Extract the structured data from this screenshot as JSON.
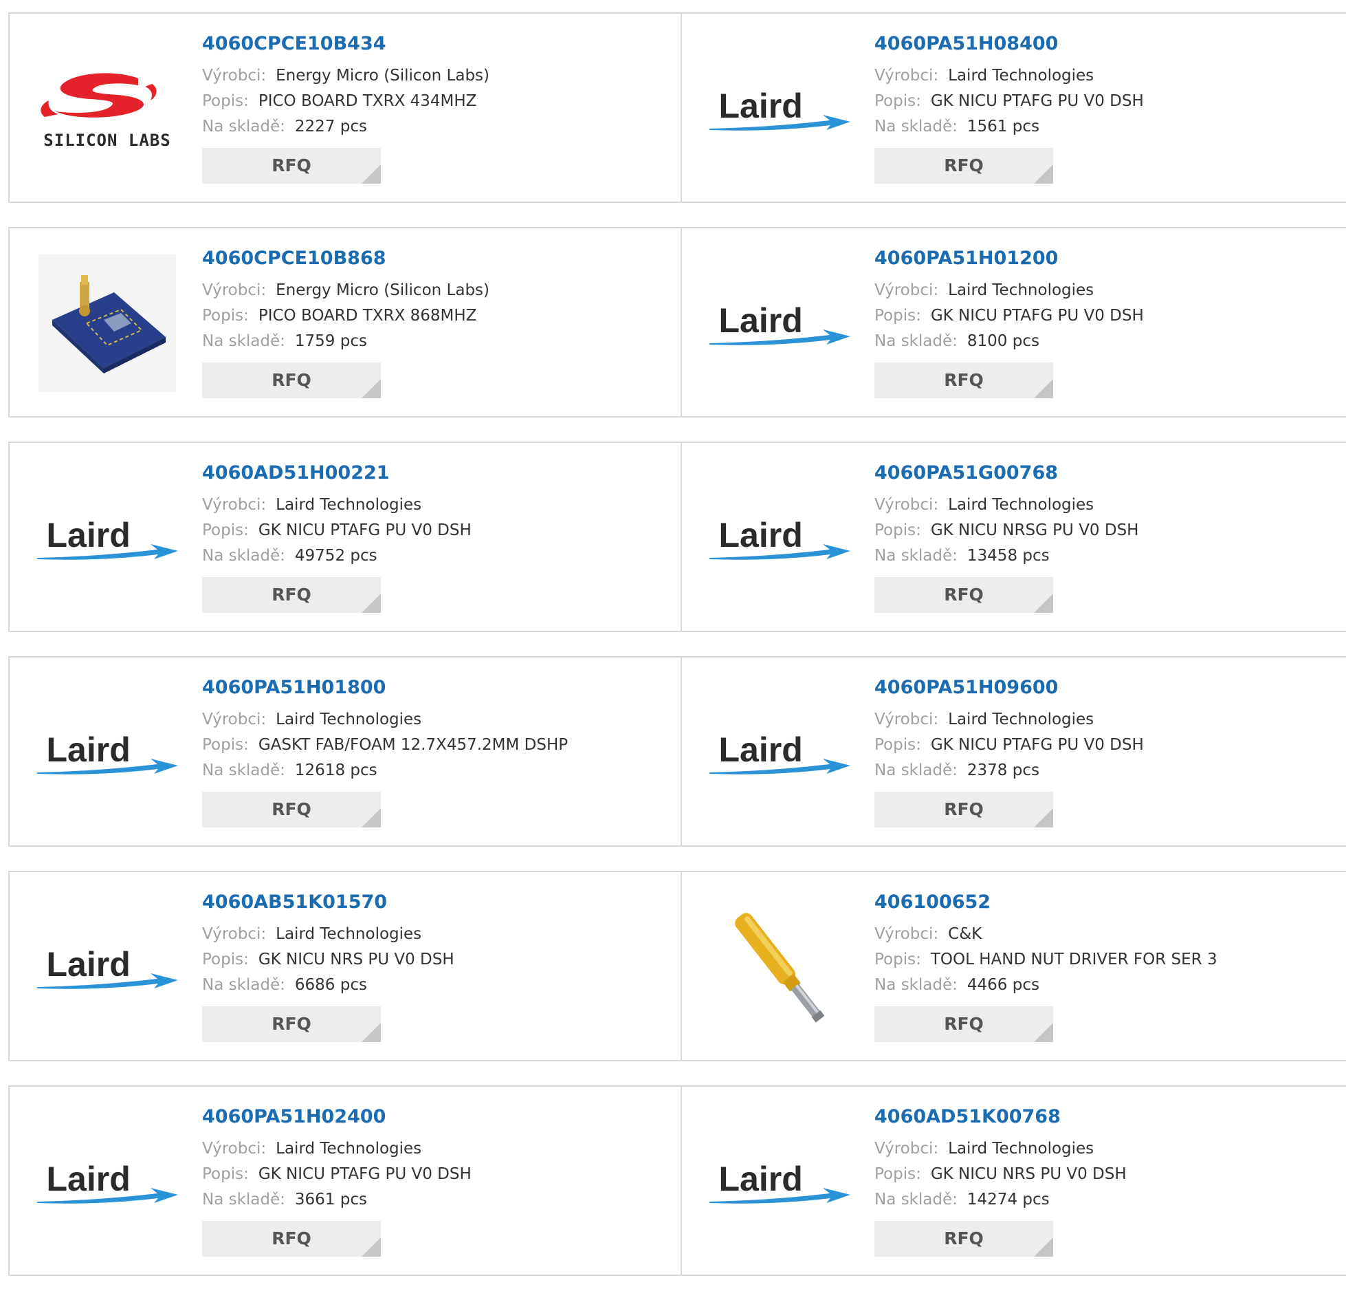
{
  "labels": {
    "manufacturer": "Výrobci:",
    "description": "Popis:",
    "stock": "Na skladě:",
    "rfq": "RFQ"
  },
  "logos": {
    "laird": "Laird",
    "silicon_labs": "SILICON LABS"
  },
  "colors": {
    "part_link": "#1a6bb0",
    "label": "#a0a0a0",
    "value": "#333333",
    "rfq_bg": "#ececec",
    "laird_swoosh": "#2a93d5",
    "silabs_red": "#e3222a"
  },
  "products": [
    {
      "part": "4060CPCE10B434",
      "manufacturer": "Energy Micro (Silicon Labs)",
      "description": "PICO BOARD TXRX 434MHZ",
      "stock": "2227 pcs",
      "image": "silicon-labs-logo"
    },
    {
      "part": "4060PA51H08400",
      "manufacturer": "Laird Technologies",
      "description": "GK NICU PTAFG PU V0 DSH",
      "stock": "1561 pcs",
      "image": "laird-logo"
    },
    {
      "part": "4060CPCE10B868",
      "manufacturer": "Energy Micro (Silicon Labs)",
      "description": "PICO BOARD TXRX 868MHZ",
      "stock": "1759 pcs",
      "image": "pcb-board-photo"
    },
    {
      "part": "4060PA51H01200",
      "manufacturer": "Laird Technologies",
      "description": "GK NICU PTAFG PU V0 DSH",
      "stock": "8100 pcs",
      "image": "laird-logo"
    },
    {
      "part": "4060AD51H00221",
      "manufacturer": "Laird Technologies",
      "description": "GK NICU PTAFG PU V0 DSH",
      "stock": "49752 pcs",
      "image": "laird-logo"
    },
    {
      "part": "4060PA51G00768",
      "manufacturer": "Laird Technologies",
      "description": "GK NICU NRSG PU V0 DSH",
      "stock": "13458 pcs",
      "image": "laird-logo"
    },
    {
      "part": "4060PA51H01800",
      "manufacturer": "Laird Technologies",
      "description": "GASKT FAB/FOAM 12.7X457.2MM DSHP",
      "stock": "12618 pcs",
      "image": "laird-logo"
    },
    {
      "part": "4060PA51H09600",
      "manufacturer": "Laird Technologies",
      "description": "GK NICU PTAFG PU V0 DSH",
      "stock": "2378 pcs",
      "image": "laird-logo"
    },
    {
      "part": "4060AB51K01570",
      "manufacturer": "Laird Technologies",
      "description": "GK NICU NRS PU V0 DSH",
      "stock": "6686 pcs",
      "image": "laird-logo"
    },
    {
      "part": "406100652",
      "manufacturer": "C&K",
      "description": "TOOL HAND NUT DRIVER FOR SER 3",
      "stock": "4466 pcs",
      "image": "nut-driver-photo"
    },
    {
      "part": "4060PA51H02400",
      "manufacturer": "Laird Technologies",
      "description": "GK NICU PTAFG PU V0 DSH",
      "stock": "3661 pcs",
      "image": "laird-logo"
    },
    {
      "part": "4060AD51K00768",
      "manufacturer": "Laird Technologies",
      "description": "GK NICU NRS PU V0 DSH",
      "stock": "14274 pcs",
      "image": "laird-logo"
    }
  ]
}
